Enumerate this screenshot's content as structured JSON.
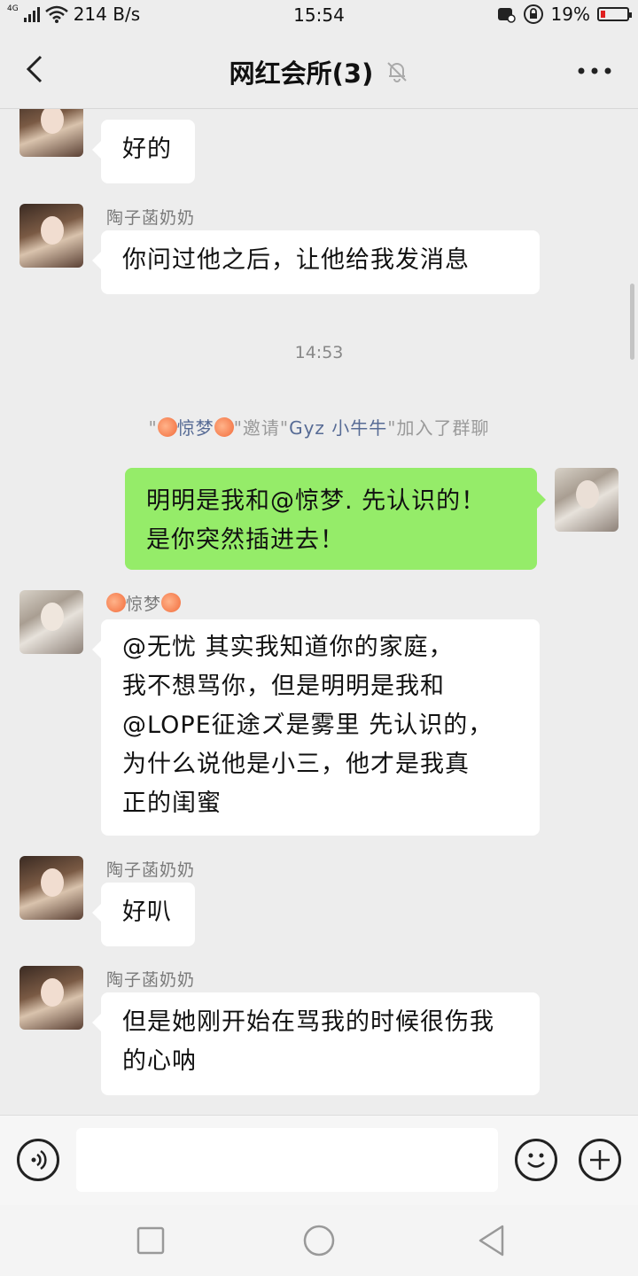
{
  "status_bar": {
    "network": "4G",
    "speed": "214 B/s",
    "time": "15:54",
    "battery": "19%",
    "battery_level": 0.19
  },
  "header": {
    "title": "网红会所(3)",
    "icons": [
      "back-arrow-icon",
      "mute-bell-icon",
      "more-dots-icon"
    ]
  },
  "messages": [
    {
      "sender": "陶子菡奶奶",
      "text": "好的"
    },
    {
      "sender": "陶子菡奶奶",
      "text": "你问过他之后，让他给我发消息"
    },
    {
      "timestamp": "14:53"
    },
    {
      "system": {
        "q1": "\"",
        "name1": "惊梦",
        "mid": "\"邀请\"",
        "name2": "Gyz 小牛牛",
        "end": "\"加入了群聊"
      }
    },
    {
      "self": true,
      "line1": "明明是我和@惊梦. 先认识的！",
      "line2": "是你突然插进去！"
    },
    {
      "sender": "惊梦",
      "lines": [
        "@无忧 其实我知道你的家庭，",
        "我不想骂你，但是明明是我和",
        "@LOPE征途ズ是雾里 先认识的，",
        "为什么说他是小三，他才是我真",
        "正的闺蜜"
      ]
    },
    {
      "sender": "陶子菡奶奶",
      "text": "好叭"
    },
    {
      "sender": "陶子菡奶奶",
      "lines": [
        "但是她刚开始在骂我的时候很伤我",
        "的心呐"
      ]
    }
  ],
  "input_bar": {
    "value": "",
    "icons": [
      "voice-icon",
      "emoji-icon",
      "plus-icon"
    ]
  },
  "system_nav": [
    "square-icon",
    "circle-icon",
    "back-triangle-icon"
  ],
  "colors": {
    "background": "#ededed",
    "self_bubble": "#95ec69",
    "other_bubble": "#ffffff",
    "link": "#576b95"
  }
}
